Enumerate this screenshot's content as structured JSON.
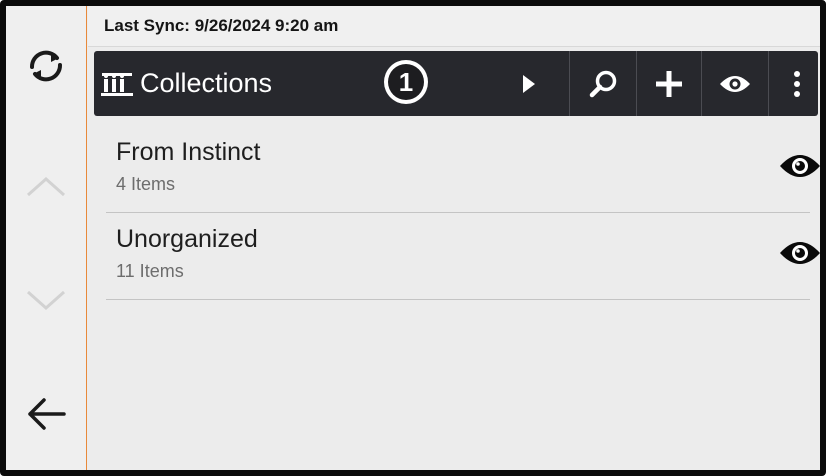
{
  "sync": {
    "text": "Last Sync: 9/26/2024 9:20 am"
  },
  "toolbar": {
    "title": "Collections",
    "callout": "1",
    "icons": [
      "collections-icon",
      "play-icon",
      "search-icon",
      "plus-icon",
      "eye-icon",
      "more-vert-icon"
    ]
  },
  "rail": {
    "icons": [
      "sync-icon",
      "chevron-up-icon",
      "chevron-down-icon",
      "back-arrow-icon"
    ]
  },
  "collections": [
    {
      "name": "From Instinct",
      "count": "4 Items"
    },
    {
      "name": "Unorganized",
      "count": "11 Items"
    }
  ],
  "colors": {
    "toolbar_bg": "#27282d",
    "accent_divider": "#e8893a",
    "content_bg": "#ececec"
  }
}
